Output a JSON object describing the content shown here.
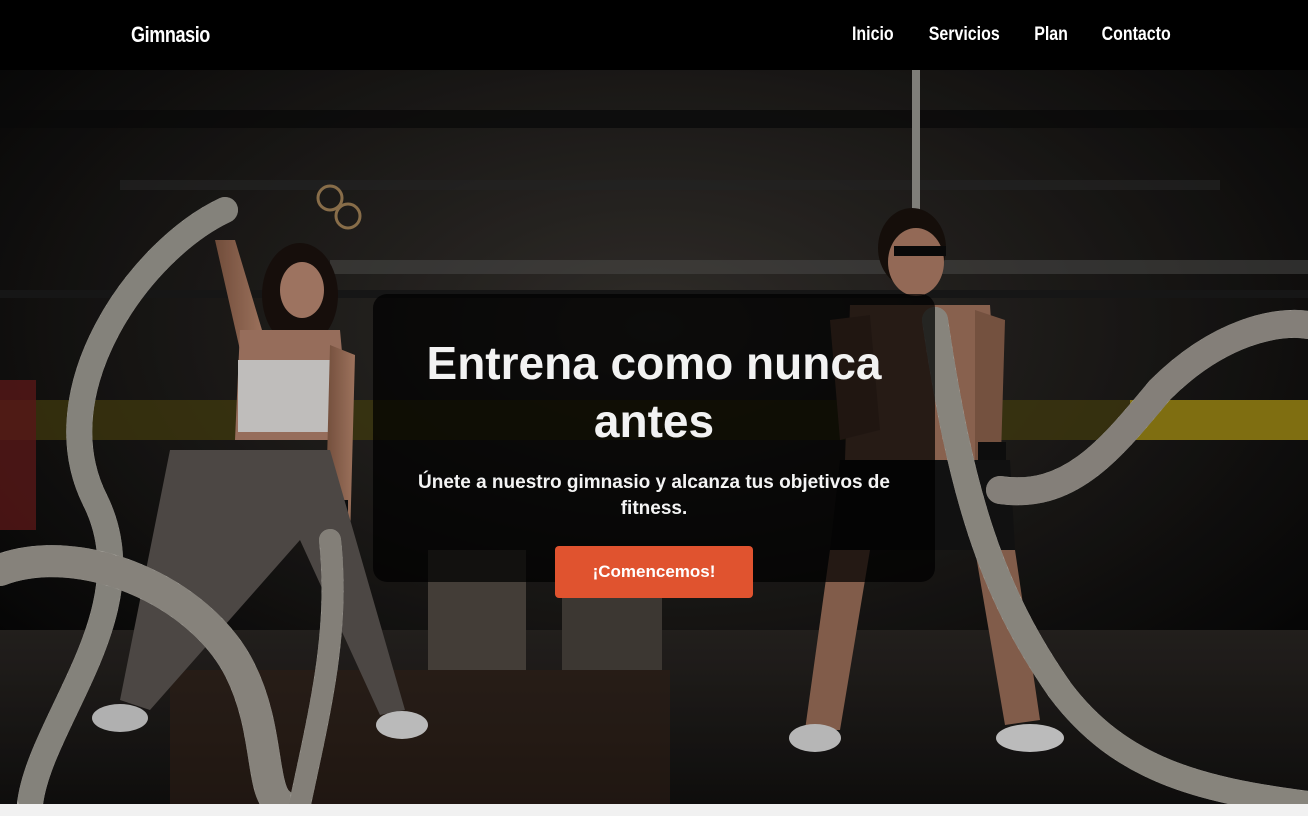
{
  "nav": {
    "brand": "Gimnasio",
    "links": [
      "Inicio",
      "Servicios",
      "Plan",
      "Contacto"
    ]
  },
  "hero": {
    "title": "Entrena como nunca antes",
    "subtitle": "Únete a nuestro gimnasio y alcanza tus objetivos de fitness.",
    "cta": "¡Comencemos!"
  },
  "colors": {
    "nav_bg": "#000000",
    "accent": "#e0532f",
    "text": "#ffffff"
  }
}
